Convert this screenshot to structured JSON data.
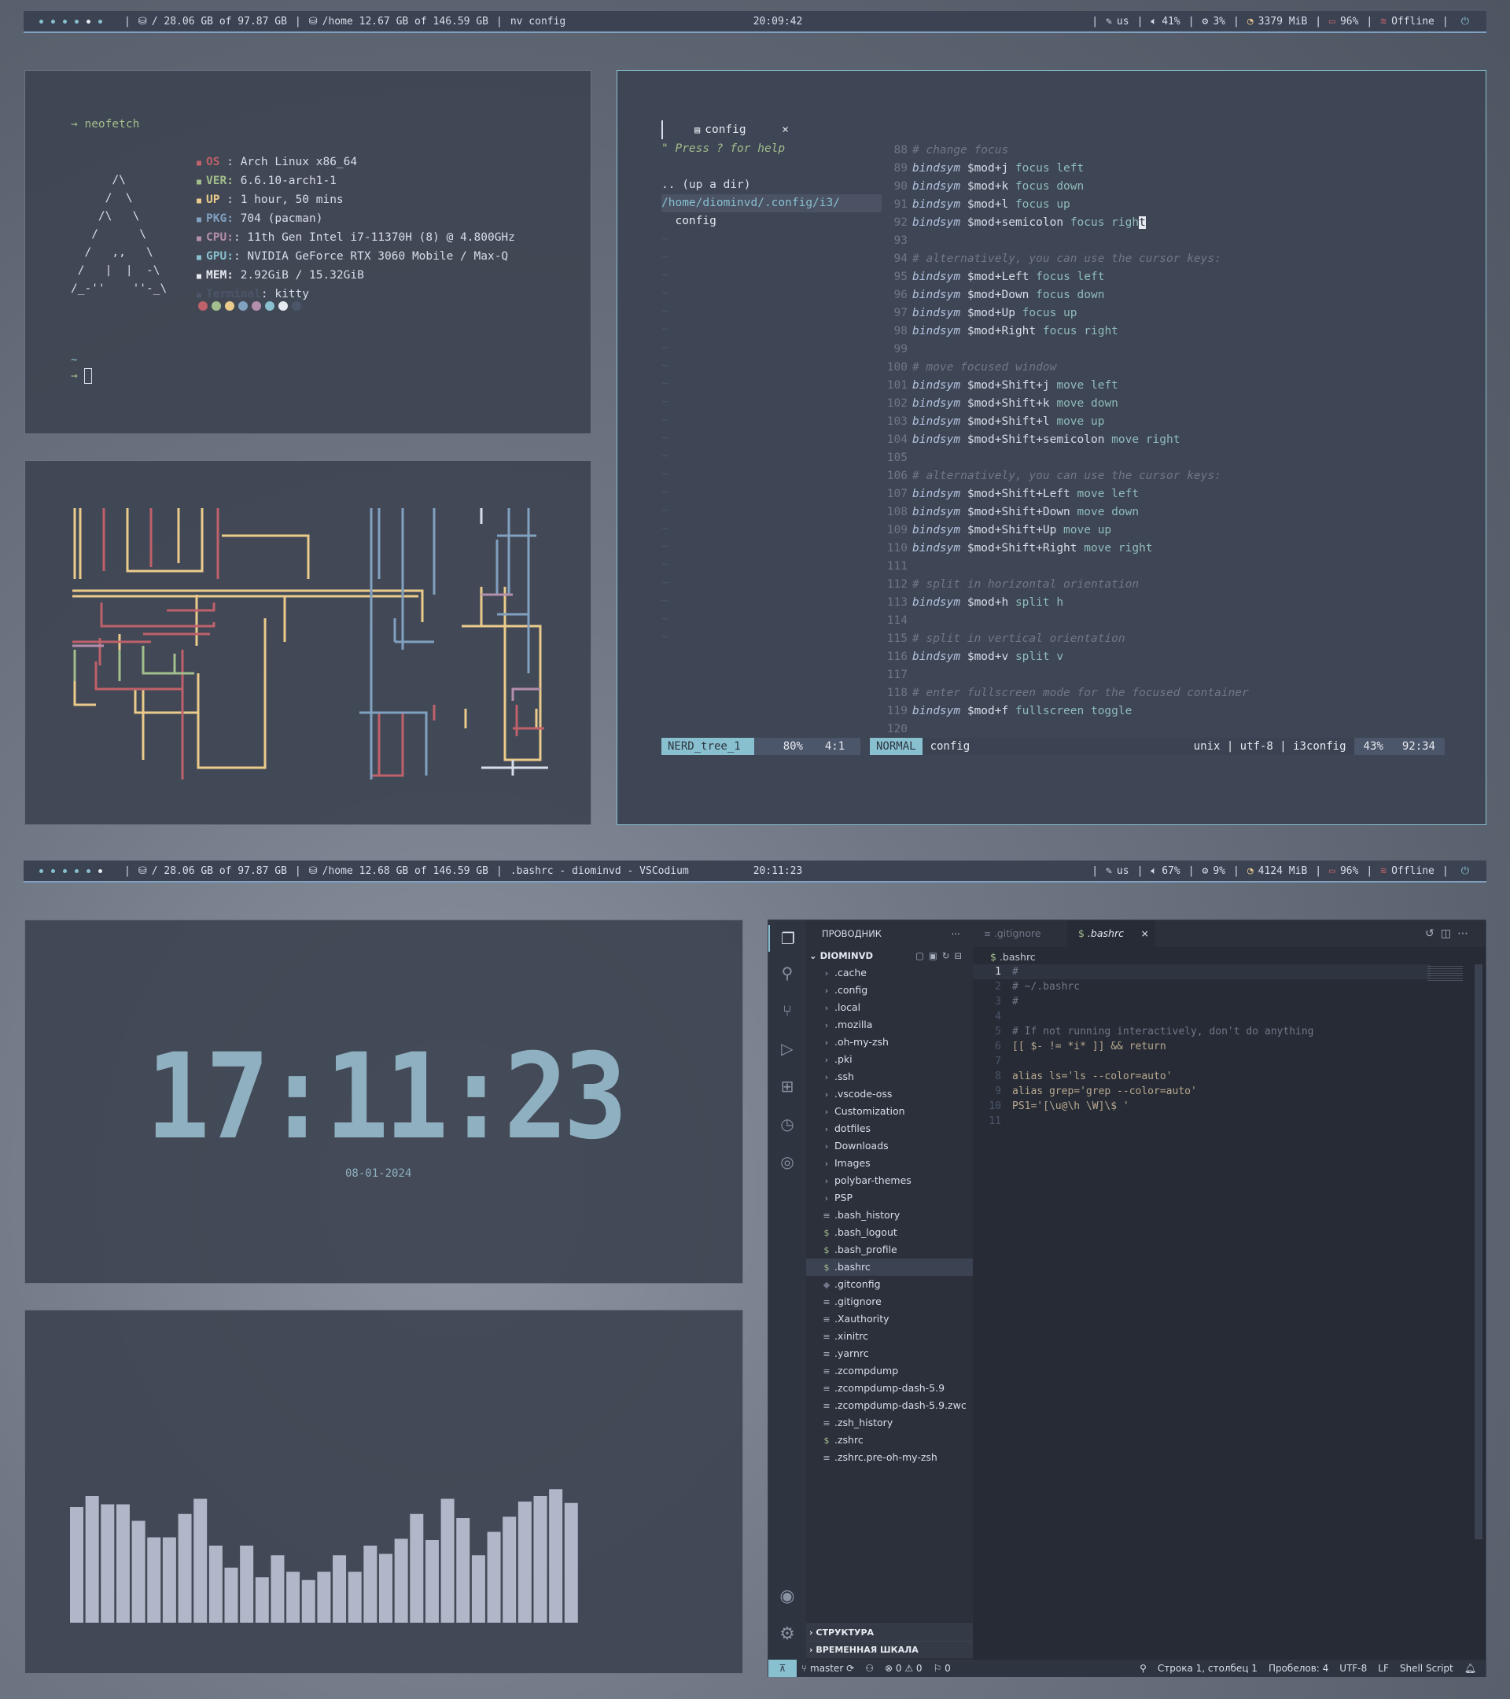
{
  "bar1": {
    "root": "/ 28.06 GB of 97.87 GB",
    "home": "/home 12.67 GB of 146.59 GB",
    "title": "nv config",
    "time": "20:09:42",
    "kbd": "us",
    "vol": "41%",
    "cpu": "3%",
    "mem": "3379 MiB",
    "bat": "96%",
    "net": "Offline"
  },
  "bar2": {
    "root": "/ 28.06 GB of 97.87 GB",
    "home": "/home 12.68 GB of 146.59 GB",
    "title": ".bashrc - diominvd - VSCodium",
    "time": "20:11:23",
    "kbd": "us",
    "vol": "67%",
    "cpu": "9%",
    "mem": "4124 MiB",
    "bat": "96%",
    "net": "Offline"
  },
  "neofetch": {
    "cmd": "→ neofetch",
    "ascii": [
      "      /\\",
      "     /  \\",
      "    /\\   \\",
      "   /      \\",
      "  /   ,,   \\",
      " /   |  |  -\\",
      "/_-''    ''-_\\"
    ],
    "info": [
      {
        "k": "OS",
        "v": " : Arch Linux x86_64",
        "c": "#bf616a"
      },
      {
        "k": "VER:",
        "v": " 6.6.10-arch1-1",
        "c": "#a3be8c"
      },
      {
        "k": "UP",
        "v": " : 1 hour, 50 mins",
        "c": "#ebcb8b"
      },
      {
        "k": "PKG:",
        "v": " 704 (pacman)",
        "c": "#81a1c1"
      },
      {
        "k": "CPU:",
        "v": ": 11th Gen Intel i7-11370H (8) @ 4.800GHz",
        "c": "#b48ead"
      },
      {
        "k": "GPU:",
        "v": ": NVIDIA GeForce RTX 3060 Mobile / Max-Q",
        "c": "#88c0d0"
      },
      {
        "k": "MEM:",
        "v": " 2.92GiB / 15.32GiB",
        "c": "#e5e9f0"
      },
      {
        "k": "Terminal",
        "v": ": kitty",
        "c": "#4c566a"
      }
    ],
    "tilde": "~",
    "prompt": "→"
  },
  "nvim": {
    "tab": "config",
    "help": "\" Press ? for help",
    "tree": [
      ".. (up a dir)",
      "/home/diominvd/.config/i3/",
      "  config"
    ],
    "lines": [
      {
        "n": "88",
        "t": "c",
        "s": "# change focus"
      },
      {
        "n": "89",
        "t": "b",
        "a": "$mod+j",
        "b": " focus left"
      },
      {
        "n": "90",
        "t": "b",
        "a": "$mod+k",
        "b": " focus down"
      },
      {
        "n": "91",
        "t": "b",
        "a": "$mod+l",
        "b": " focus up"
      },
      {
        "n": "92",
        "t": "b",
        "a": "$mod+semicolon",
        "b": " focus right"
      },
      {
        "n": "93",
        "t": "e"
      },
      {
        "n": "94",
        "t": "c",
        "s": "# alternatively, you can use the cursor keys:"
      },
      {
        "n": "95",
        "t": "b",
        "a": "$mod+Left",
        "b": " focus left"
      },
      {
        "n": "96",
        "t": "b",
        "a": "$mod+Down",
        "b": " focus down"
      },
      {
        "n": "97",
        "t": "b",
        "a": "$mod+Up",
        "b": " focus up"
      },
      {
        "n": "98",
        "t": "b",
        "a": "$mod+Right",
        "b": " focus right"
      },
      {
        "n": "99",
        "t": "e"
      },
      {
        "n": "100",
        "t": "c",
        "s": "# move focused window"
      },
      {
        "n": "101",
        "t": "b",
        "a": "$mod+Shift+j",
        "b": " move left"
      },
      {
        "n": "102",
        "t": "b",
        "a": "$mod+Shift+k",
        "b": " move down"
      },
      {
        "n": "103",
        "t": "b",
        "a": "$mod+Shift+l",
        "b": " move up"
      },
      {
        "n": "104",
        "t": "b",
        "a": "$mod+Shift+semicolon",
        "b": " move right"
      },
      {
        "n": "105",
        "t": "e"
      },
      {
        "n": "106",
        "t": "c",
        "s": "# alternatively, you can use the cursor keys:"
      },
      {
        "n": "107",
        "t": "b",
        "a": "$mod+Shift+Left",
        "b": " move left"
      },
      {
        "n": "108",
        "t": "b",
        "a": "$mod+Shift+Down",
        "b": " move down"
      },
      {
        "n": "109",
        "t": "b",
        "a": "$mod+Shift+Up",
        "b": " move up"
      },
      {
        "n": "110",
        "t": "b",
        "a": "$mod+Shift+Right",
        "b": " move right"
      },
      {
        "n": "111",
        "t": "e"
      },
      {
        "n": "112",
        "t": "c",
        "s": "# split in horizontal orientation"
      },
      {
        "n": "113",
        "t": "b",
        "a": "$mod+h",
        "b": " split h"
      },
      {
        "n": "114",
        "t": "e"
      },
      {
        "n": "115",
        "t": "c",
        "s": "# split in vertical orientation"
      },
      {
        "n": "116",
        "t": "b",
        "a": "$mod+v",
        "b": " split v"
      },
      {
        "n": "117",
        "t": "e"
      },
      {
        "n": "118",
        "t": "c",
        "s": "# enter fullscreen mode for the focused container"
      },
      {
        "n": "119",
        "t": "b",
        "a": "$mod+f",
        "b": " fullscreen toggle"
      },
      {
        "n": "120",
        "t": "e"
      }
    ],
    "kw": "bindsym",
    "status": {
      "tree": "NERD_tree_1",
      "pct": "80%",
      "pos": "4:1",
      "mode": "NORMAL",
      "file": "config",
      "enc": "unix | utf-8 | i3config",
      "pct2": "43%",
      "pos2": "92:34"
    }
  },
  "clock": {
    "time": "17:11:23",
    "date": "08-01-2024"
  },
  "cava": [
    0.84,
    0.92,
    0.86,
    0.86,
    0.74,
    0.62,
    0.62,
    0.79,
    0.9,
    0.56,
    0.4,
    0.56,
    0.33,
    0.49,
    0.37,
    0.31,
    0.37,
    0.49,
    0.37,
    0.56,
    0.5,
    0.61,
    0.79,
    0.6,
    0.9,
    0.76,
    0.49,
    0.66,
    0.77,
    0.88,
    0.92,
    0.97,
    0.87
  ],
  "vscode": {
    "explorer": "ПРОВОДНИК",
    "root": "DIOMINVD",
    "tabs": [
      ".gitignore",
      ".bashrc"
    ],
    "breadcrumb": ".bashrc",
    "folders": [
      ".cache",
      ".config",
      ".local",
      ".mozilla",
      ".oh-my-zsh",
      ".pki",
      ".ssh",
      ".vscode-oss",
      "Customization",
      "dotfiles",
      "Downloads",
      "Images",
      "polybar-themes",
      "PSP"
    ],
    "files": [
      {
        "n": ".bash_history",
        "i": "≡"
      },
      {
        "n": ".bash_logout",
        "i": "$"
      },
      {
        "n": ".bash_profile",
        "i": "$"
      },
      {
        "n": ".bashrc",
        "i": "$",
        "sel": true
      },
      {
        "n": ".gitconfig",
        "i": "◆"
      },
      {
        "n": ".gitignore",
        "i": "≡"
      },
      {
        "n": ".Xauthority",
        "i": "≡"
      },
      {
        "n": ".xinitrc",
        "i": "≡"
      },
      {
        "n": ".yarnrc",
        "i": "≡"
      },
      {
        "n": ".zcompdump",
        "i": "≡"
      },
      {
        "n": ".zcompdump-dash-5.9",
        "i": "≡"
      },
      {
        "n": ".zcompdump-dash-5.9.zwc",
        "i": "≡"
      },
      {
        "n": ".zsh_history",
        "i": "≡"
      },
      {
        "n": ".zshrc",
        "i": "$"
      },
      {
        "n": ".zshrc.pre-oh-my-zsh",
        "i": "≡"
      }
    ],
    "code": [
      "#",
      "# ~/.bashrc",
      "#",
      "",
      "# If not running interactively, don't do anything",
      "[[ $- != *i* ]] && return",
      "",
      "alias ls='ls --color=auto'",
      "alias grep='grep --color=auto'",
      "PS1='[\\u@\\h \\W]\\$ '",
      ""
    ],
    "outline": "СТРУКТУРА",
    "timeline": "ВРЕМЕННАЯ ШКАЛА",
    "status": {
      "branch": "master",
      "errors": "0",
      "warnings": "0",
      "ports": "0",
      "pos": "Строка 1, столбец 1",
      "spaces": "Пробелов: 4",
      "enc": "UTF-8",
      "eol": "LF",
      "lang": "Shell Script"
    }
  }
}
